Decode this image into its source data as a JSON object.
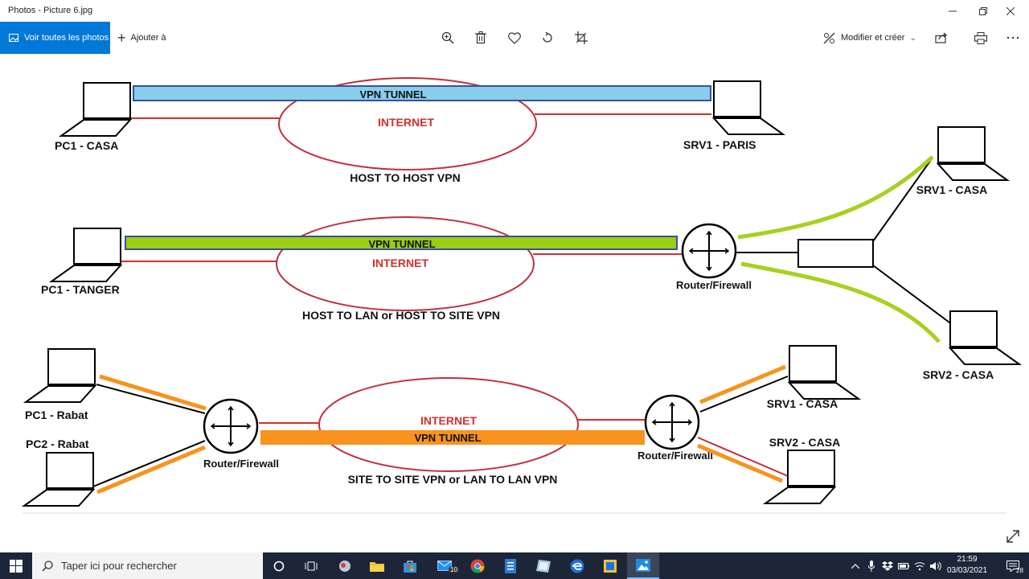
{
  "window": {
    "title": "Photos - Picture 6.jpg"
  },
  "toolbar": {
    "view_all_label": "Voir toutes les photos",
    "add_to_label": "Ajouter à",
    "edit_create_label": "Modifier et créer"
  },
  "diagram": {
    "row1": {
      "tunnel_label": "VPN TUNNEL",
      "internet_label": "INTERNET",
      "left_label": "PC1 - CASA",
      "right_label": "SRV1 - PARIS",
      "caption": "HOST TO HOST VPN"
    },
    "row2": {
      "tunnel_label": "VPN TUNNEL",
      "internet_label": "INTERNET",
      "left_label": "PC1 - TANGER",
      "router_label": "Router/Firewall",
      "srv1_label": "SRV1 - CASA",
      "srv2_label": "SRV2 - CASA",
      "caption": "HOST TO LAN or HOST TO SITE VPN"
    },
    "row3": {
      "tunnel_label": "VPN TUNNEL",
      "internet_label": "INTERNET",
      "pc1_label": "PC1 - Rabat",
      "pc2_label": "PC2 - Rabat",
      "router_left_label": "Router/Firewall",
      "router_right_label": "Router/Firewall",
      "srv1_label": "SRV1 - CASA",
      "srv2_label": "SRV2 - CASA",
      "caption": "SITE TO SITE VPN or LAN TO LAN VPN"
    },
    "colors": {
      "tunnel_blue": "#87ceeb",
      "tunnel_green": "#9acd14",
      "tunnel_orange": "#f7931e",
      "internet_red": "#d03030"
    }
  },
  "taskbar": {
    "search_placeholder": "Taper ici pour rechercher",
    "time": "21:59",
    "date": "03/03/2021",
    "mail_badge": "10",
    "notification_badge": "28"
  }
}
